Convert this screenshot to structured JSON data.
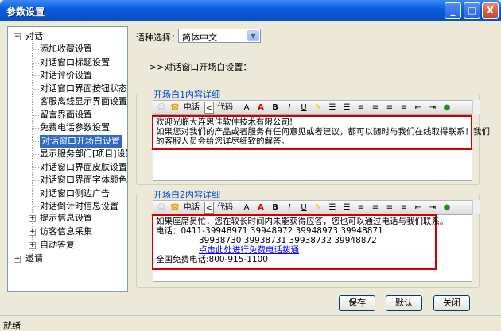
{
  "window": {
    "title": "参数设置",
    "min": "_",
    "max": "□",
    "close": "X"
  },
  "tree": {
    "root1": "对话",
    "children": [
      "添加收藏设置",
      "对话窗口标题设置",
      "对话评价设置",
      "对话窗口界面按钮状态",
      "客服离线显示界面设置",
      "留言界面设置",
      "免费电话参数设置",
      "对话窗口开场白设置",
      "显示服务部门[项目]设置",
      "对话窗口界面皮肤设置",
      "对话窗口界面字体颜色",
      "对话窗口侧边广告",
      "对话倒计时信息设置"
    ],
    "sub": [
      "提示信息设置",
      "访客信息采集",
      "自动答复"
    ],
    "root2": "邀请"
  },
  "lang": {
    "label": "语种选择：",
    "value": "简体中文"
  },
  "section_title": ">>对话窗口开场白设置：",
  "group1": {
    "label": "开场白1内容详细",
    "line1": "欢迎光临大连思佳软件技术有限公司!",
    "line2": "如果您对我们的产品或者服务有任何意见或者建议，都可以随时与我们在线取得联系！我们",
    "line3": "的客服人员会给您详尽细致的解答。"
  },
  "group2": {
    "label": "开场白2内容详细",
    "line1": "如果座席员忙，您在较长时间内未能获得应答，您也可以通过电话与我们联系。",
    "line2": "电话：0411-39948971 39948972 39948973 39948871",
    "line3": "39938730 39938731 39938732 39948872",
    "link": "点击此处进行免费电话拨通",
    "line4": "全国免费电话:800-915-1100"
  },
  "toolbar": {
    "phone": "电话",
    "code": "代码",
    "b": "B",
    "i": "I",
    "u": "U"
  },
  "buttons": {
    "save": "保存",
    "default": "默认",
    "close": "关闭"
  },
  "status": "就绪"
}
